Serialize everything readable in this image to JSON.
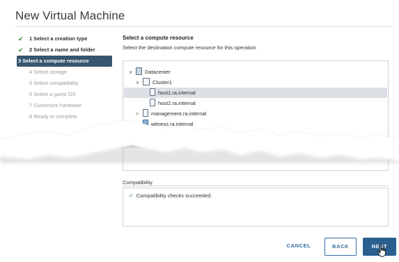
{
  "dialog": {
    "title": "New Virtual Machine"
  },
  "steps": [
    {
      "label": "1 Select a creation type",
      "state": "done"
    },
    {
      "label": "2 Select a name and folder",
      "state": "done"
    },
    {
      "label": "3 Select a compute resource",
      "state": "active"
    },
    {
      "label": "4 Select storage",
      "state": "pending"
    },
    {
      "label": "5 Select compatibility",
      "state": "pending"
    },
    {
      "label": "6 Select a guest OS",
      "state": "pending"
    },
    {
      "label": "7 Customize hardware",
      "state": "pending"
    },
    {
      "label": "8 Ready to complete",
      "state": "pending"
    }
  ],
  "main": {
    "heading": "Select a compute resource",
    "subheading": "Select the destination compute resource for this operation",
    "tree": [
      {
        "label": "Datacenter",
        "icon": "datacenter-icon",
        "caret": "∨"
      },
      {
        "label": "Cluster1",
        "icon": "cluster-icon",
        "caret": "∨"
      },
      {
        "label": "host1.ra.internal",
        "icon": "host-icon",
        "caret": "",
        "selected": true
      },
      {
        "label": "host2.ra.internal",
        "icon": "host-icon",
        "caret": ""
      },
      {
        "label": "management.ra.internal",
        "icon": "host-icon",
        "caret": ">"
      },
      {
        "label": "witness.ra.internal",
        "icon": "witness-host-icon",
        "caret": ">"
      }
    ]
  },
  "compatibility": {
    "label": "Compatibility",
    "message": "Compatibility checks succeeded."
  },
  "footer": {
    "cancel": "CANCEL",
    "back": "BACK",
    "next": "NEXT"
  },
  "colors": {
    "active_step_bg": "#37556e",
    "check_green": "#2e8a2e",
    "primary_button": "#2a5f8f"
  }
}
